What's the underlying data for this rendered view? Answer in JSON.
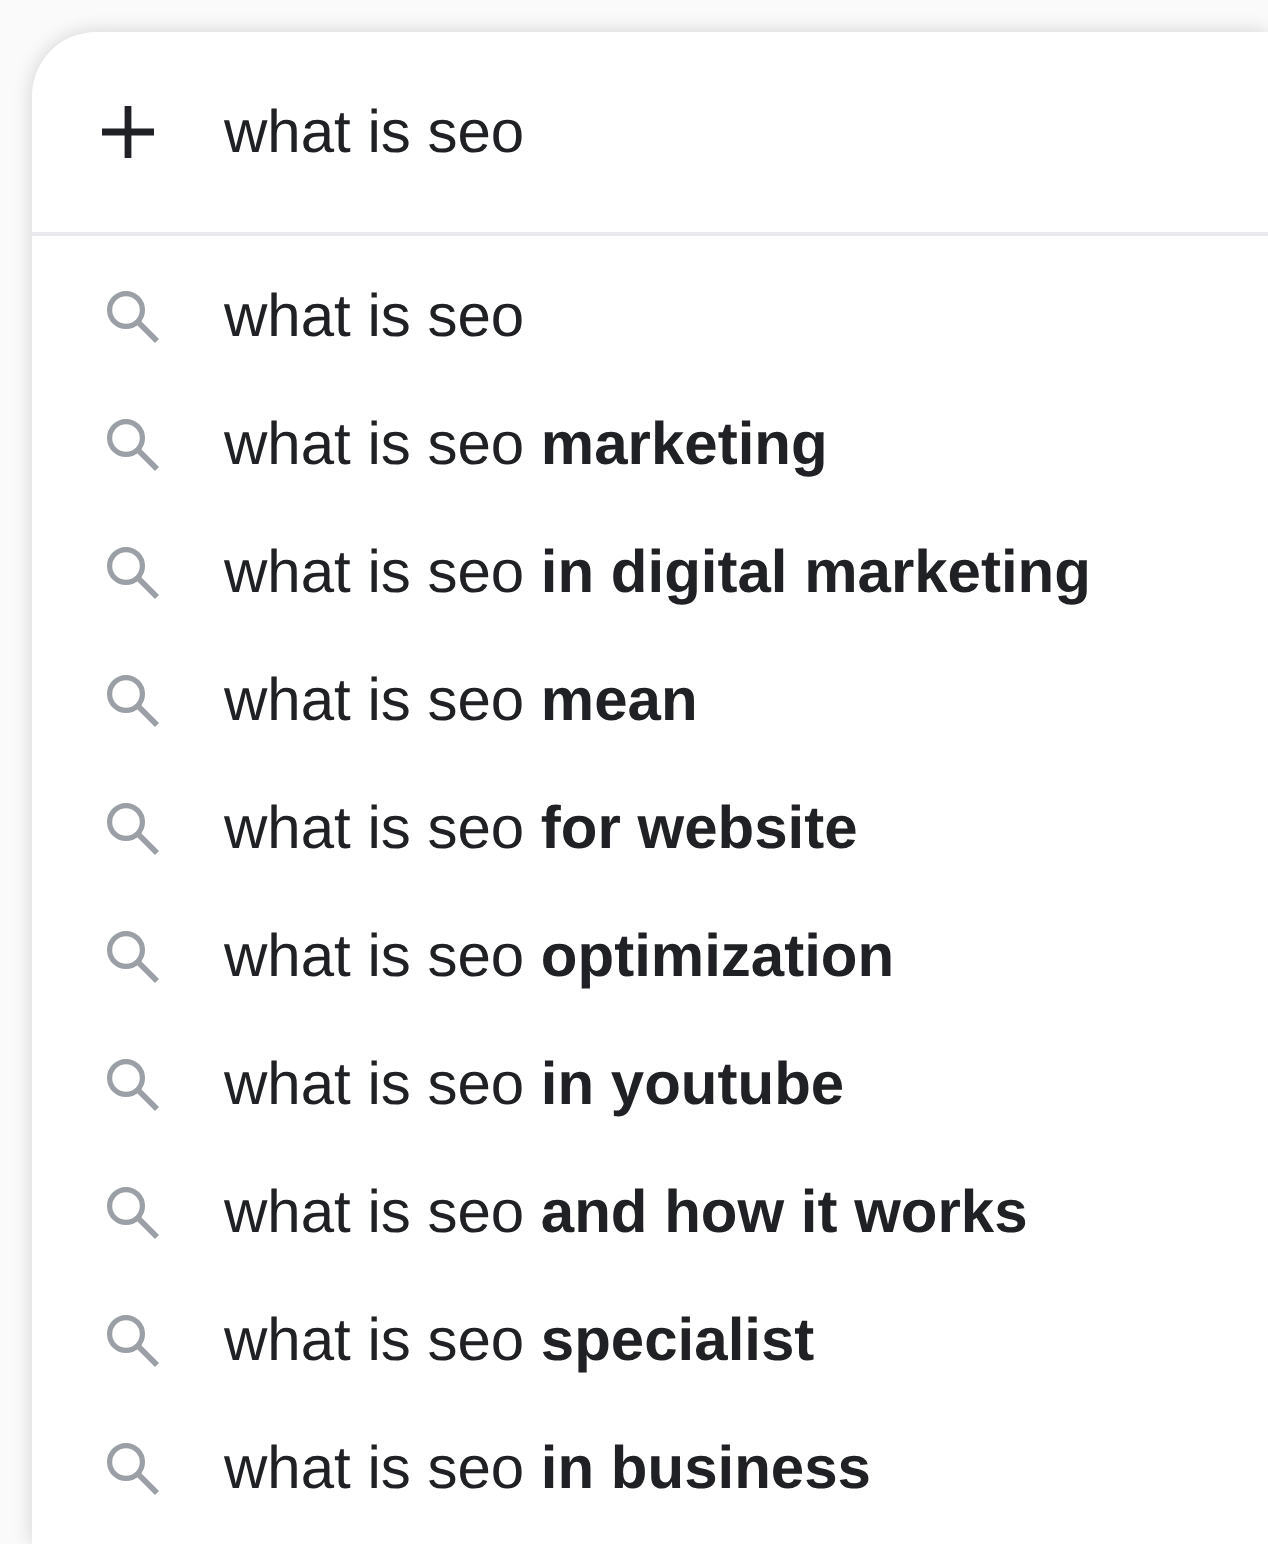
{
  "search_box": {
    "value": "what is seo"
  },
  "suggestions": [
    {
      "text": "what is seo"
    },
    {
      "text": "what is seo **marketing**"
    },
    {
      "text": "what is seo **in digital marketing**"
    },
    {
      "text": "what is seo **mean**"
    },
    {
      "text": "what is seo **for website**"
    },
    {
      "text": "what is seo **optimization**"
    },
    {
      "text": "what is seo **in youtube**"
    },
    {
      "text": "what is seo **and how it works**"
    },
    {
      "text": "what is seo **specialist**"
    },
    {
      "text": "what is seo **in business**"
    }
  ]
}
